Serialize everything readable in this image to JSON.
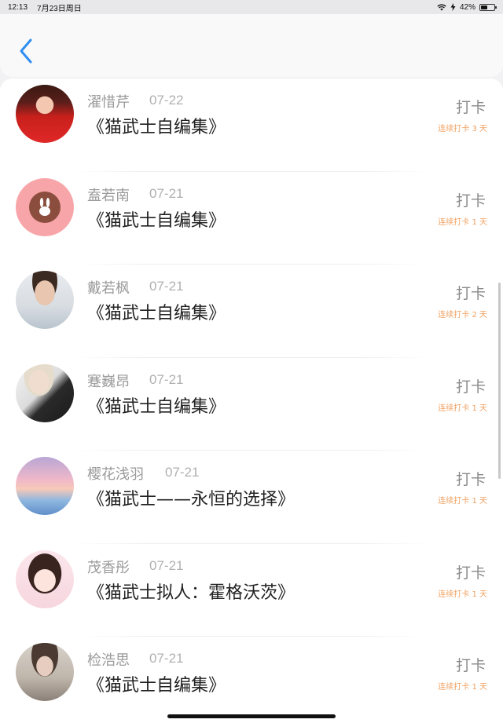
{
  "status": {
    "time": "12:13",
    "date": "7月23日周日",
    "battery": "42%"
  },
  "colors": {
    "accent": "#2f8ef0",
    "streak": "#f0a060",
    "name": "#9a9a9a",
    "title": "#222222"
  },
  "icons": {
    "back": "chevron-left-icon",
    "wifi": "wifi-icon",
    "charging": "charging-icon",
    "battery": "battery-icon"
  },
  "entries": [
    {
      "name": "濯惜芹",
      "date": "07-22",
      "title": "《猫武士自编集》",
      "checkin": "打卡",
      "streak": "连续打卡 3 天"
    },
    {
      "name": "盍若南",
      "date": "07-21",
      "title": "《猫武士自编集》",
      "checkin": "打卡",
      "streak": "连续打卡 1 天"
    },
    {
      "name": "戴若枫",
      "date": "07-21",
      "title": "《猫武士自编集》",
      "checkin": "打卡",
      "streak": "连续打卡 2 天"
    },
    {
      "name": "蹇巍昂",
      "date": "07-21",
      "title": "《猫武士自编集》",
      "checkin": "打卡",
      "streak": "连续打卡 1 天"
    },
    {
      "name": "樱花浅羽",
      "date": "07-21",
      "title": "《猫武士——永恒的选择》",
      "checkin": "打卡",
      "streak": "连续打卡 1 天"
    },
    {
      "name": "茂香彤",
      "date": "07-21",
      "title": "《猫武士拟人：霍格沃茨》",
      "checkin": "打卡",
      "streak": "连续打卡 1 天"
    },
    {
      "name": "检浩思",
      "date": "07-21",
      "title": "《猫武士自编集》",
      "checkin": "打卡",
      "streak": "连续打卡 1 天"
    }
  ]
}
